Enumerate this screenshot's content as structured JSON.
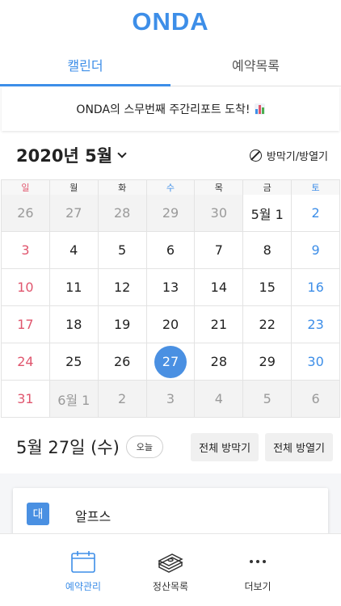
{
  "app": {
    "logo": "ONDA"
  },
  "tabs": [
    {
      "label": "캘린더",
      "active": true
    },
    {
      "label": "예약목록",
      "active": false
    }
  ],
  "notice": {
    "text": "ONDA의 스무번째 주간리포트 도착!",
    "icon": "bar-chart-icon"
  },
  "month": {
    "title": "2020년 5월",
    "toggle_label": "방막기/방열기"
  },
  "weekdays": [
    "일",
    "월",
    "화",
    "수",
    "목",
    "금",
    "토"
  ],
  "weeks": [
    [
      "26",
      "27",
      "28",
      "29",
      "30",
      "5월 1",
      "2"
    ],
    [
      "3",
      "4",
      "5",
      "6",
      "7",
      "8",
      "9"
    ],
    [
      "10",
      "11",
      "12",
      "13",
      "14",
      "15",
      "16"
    ],
    [
      "17",
      "18",
      "19",
      "20",
      "21",
      "22",
      "23"
    ],
    [
      "24",
      "25",
      "26",
      "27",
      "28",
      "29",
      "30"
    ],
    [
      "31",
      "6월 1",
      "2",
      "3",
      "4",
      "5",
      "6"
    ]
  ],
  "selected": {
    "date": "5월 27일 (수)",
    "today_chip": "오늘",
    "close_all": "전체 방막기",
    "open_all": "전체 방열기"
  },
  "room": {
    "badge": "대",
    "name": "알프스"
  },
  "bottom_nav": [
    {
      "label": "예약관리",
      "icon": "calendar-icon",
      "active": true
    },
    {
      "label": "정산목록",
      "icon": "money-stack-icon",
      "active": false
    },
    {
      "label": "더보기",
      "icon": "more-dots-icon",
      "active": false
    }
  ],
  "colors": {
    "accent": "#3d8ee8",
    "sunday": "#e0566e",
    "today_circle": "#4a90e2"
  }
}
